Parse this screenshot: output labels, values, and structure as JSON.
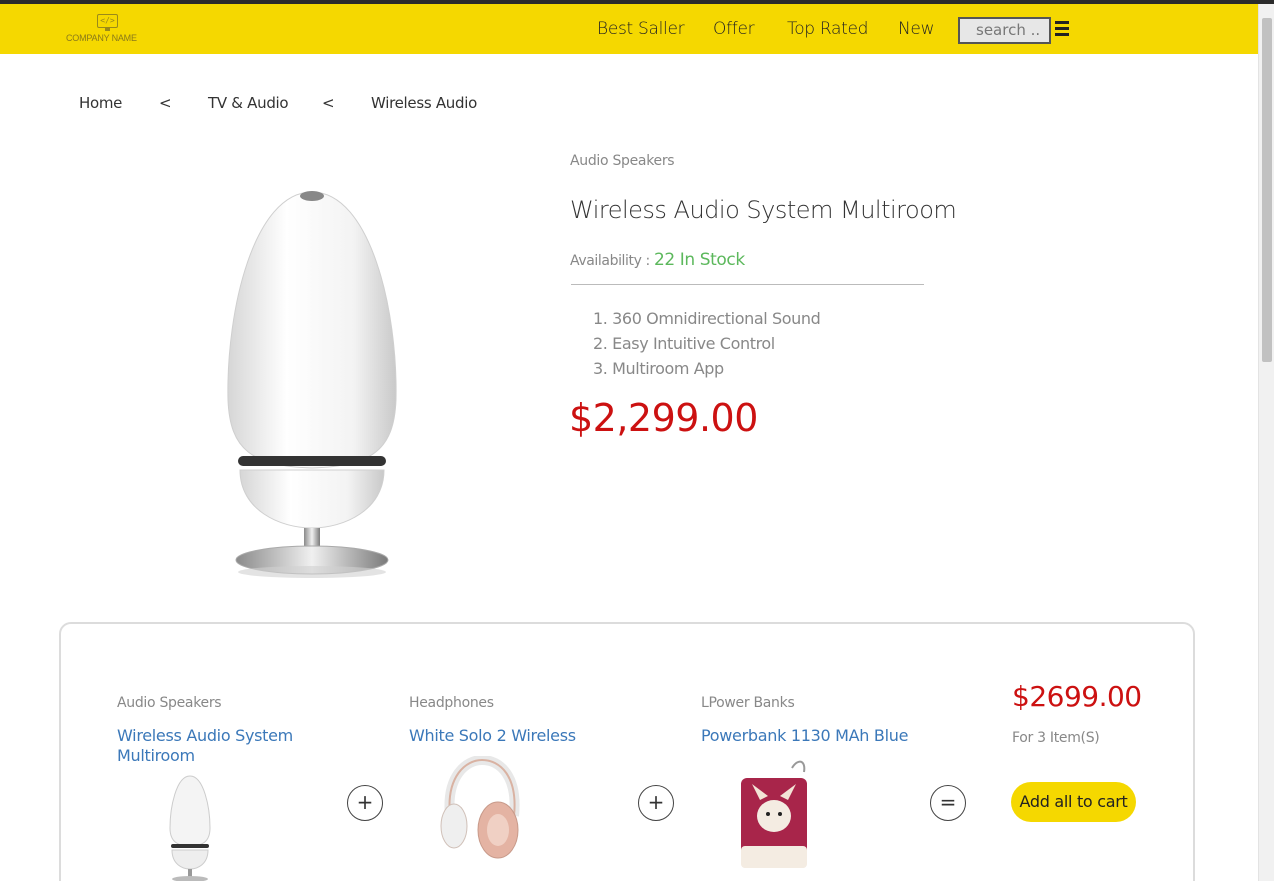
{
  "header": {
    "logo_text": "COMPANY NAME",
    "logo_mark": "</>",
    "nav": [
      "Best Saller",
      "Offer",
      "Top Rated",
      "New"
    ],
    "search_placeholder": "search .."
  },
  "breadcrumb": {
    "home": "Home",
    "sep": "<",
    "category": "TV & Audio",
    "current": "Wireless Audio"
  },
  "product": {
    "category": "Audio Speakers",
    "title": "Wireless Audio System Multiroom",
    "availability_label": "Availability : ",
    "availability_value": "22 In Stock",
    "features": [
      "1. 360 Omnidirectional Sound",
      "2. Easy Intuitive Control",
      "3. Multiroom App"
    ],
    "price": "$2,299.00"
  },
  "bundle": {
    "items": [
      {
        "category": "Audio Speakers",
        "name": "Wireless Audio System Multiroom"
      },
      {
        "category": "Headphones",
        "name": "White Solo 2 Wireless"
      },
      {
        "category": "LPower Banks",
        "name": "Powerbank 1130 MAh Blue"
      }
    ],
    "plus": "+",
    "equals": "=",
    "total": "$2699.00",
    "total_sub": "For 3 Item(S)",
    "add_all_label": "Add all to cart"
  },
  "colors": {
    "header_bg": "#f5d800",
    "price_red": "#cc1111",
    "stock_green": "#5cb85c",
    "link_blue": "#3b78b9"
  }
}
